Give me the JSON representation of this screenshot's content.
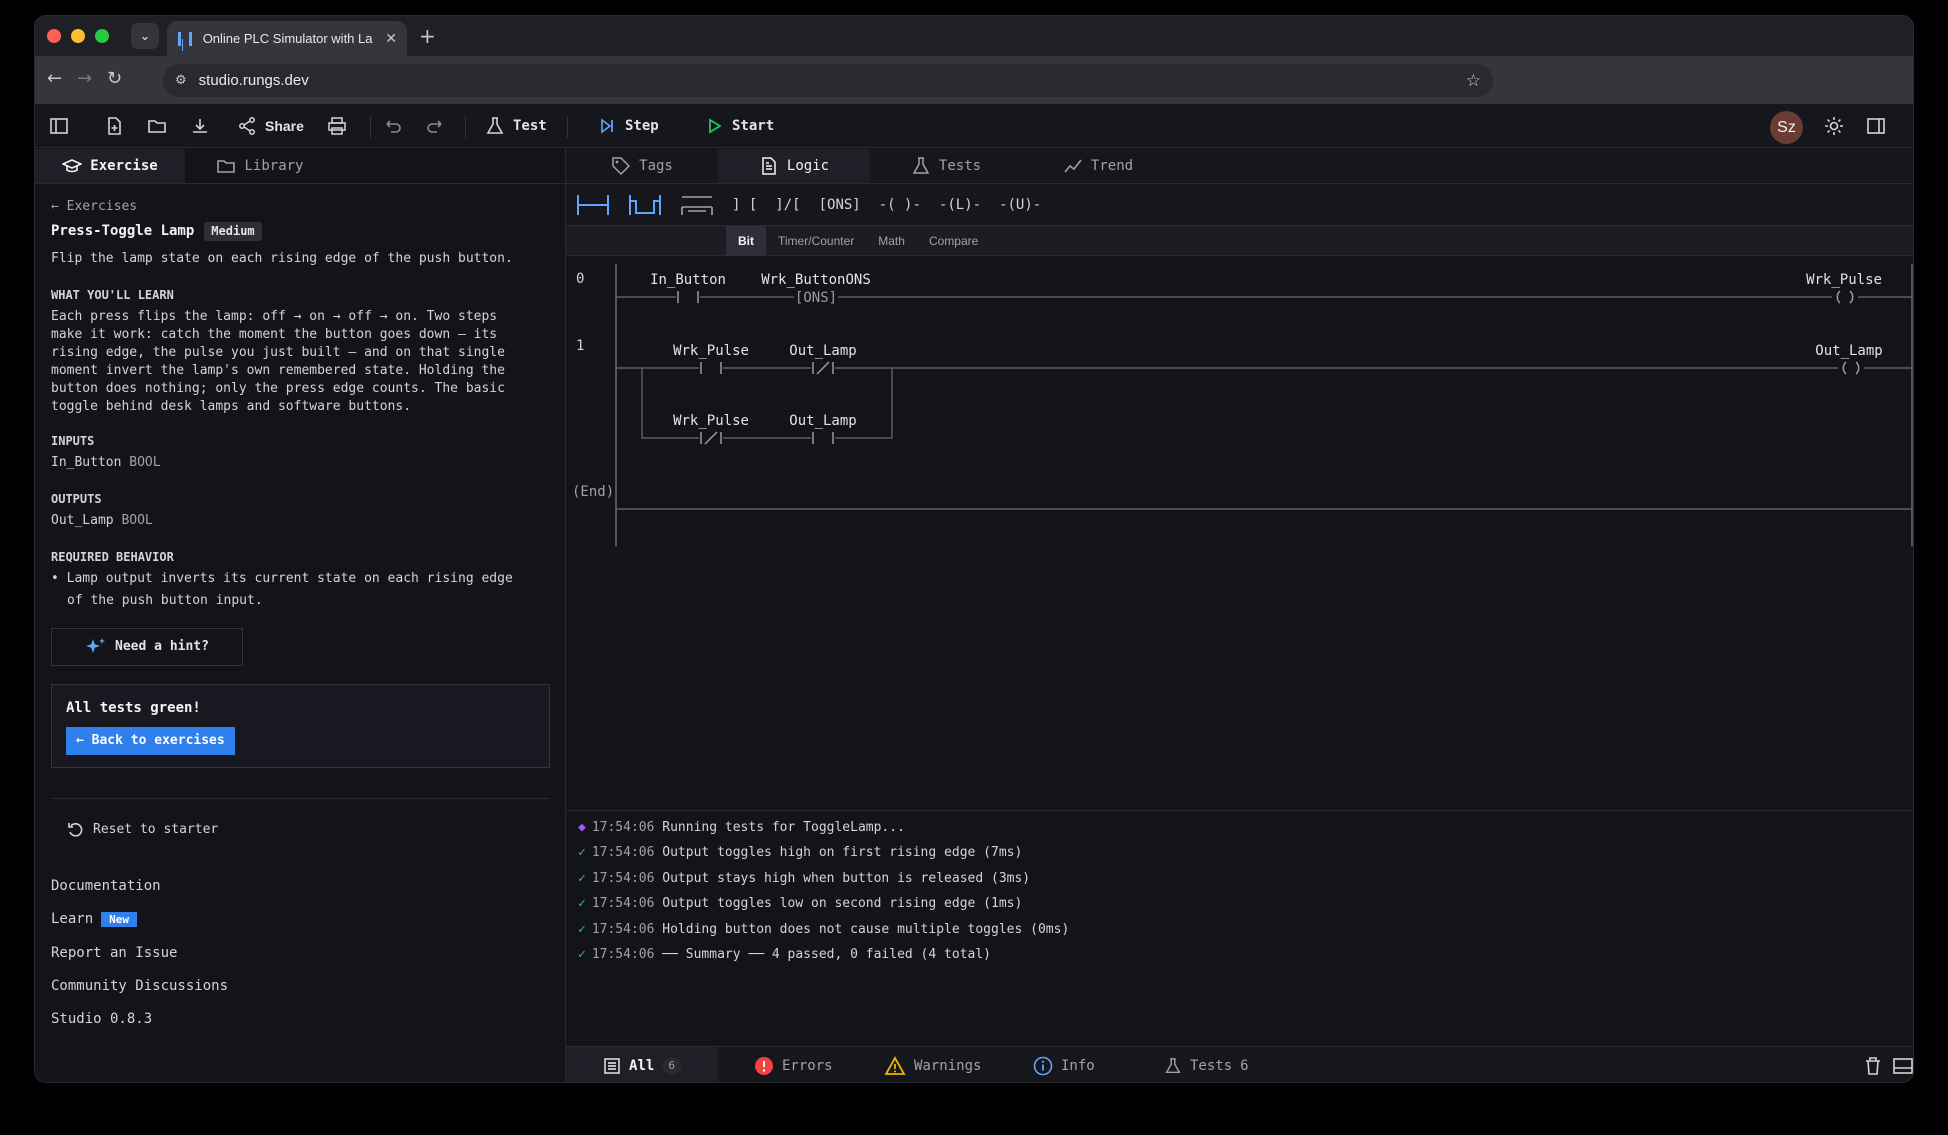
{
  "browser": {
    "tab_title": "Online PLC Simulator with La",
    "url": "studio.rungs.dev"
  },
  "toolbar": {
    "share": "Share",
    "test": "Test",
    "step": "Step",
    "start": "Start",
    "avatar": "Sz"
  },
  "left_tabs": {
    "exercise": "Exercise",
    "library": "Library"
  },
  "exercise": {
    "back": "← Exercises",
    "title": "Press-Toggle Lamp",
    "difficulty": "Medium",
    "summary": "Flip the lamp state on each rising edge of the push button.",
    "learn_heading": "WHAT YOU'LL LEARN",
    "learn_lines": [
      "Each press flips the lamp: off → on → off → on. Two steps",
      "make it work: catch the moment the button goes down — its",
      "rising edge, the pulse you just built — and on that single",
      "moment invert the lamp's own remembered state. Holding the",
      "button does nothing; only the press edge counts. The basic",
      "toggle behind desk lamps and software buttons."
    ],
    "inputs_heading": "INPUTS",
    "input_name": "In_Button",
    "input_type": "BOOL",
    "outputs_heading": "OUTPUTS",
    "output_name": "Out_Lamp",
    "output_type": "BOOL",
    "behavior_heading": "REQUIRED BEHAVIOR",
    "behavior_line1": "• Lamp output inverts its current state on each rising edge",
    "behavior_line2": "of the push button input.",
    "hint": "Need a hint?",
    "success": "All tests green!",
    "back_btn": "← Back to exercises",
    "reset": "Reset to starter"
  },
  "links": {
    "docs": "Documentation",
    "learn": "Learn",
    "learn_badge": "New",
    "report": "Report an Issue",
    "community": "Community Discussions",
    "version": "Studio 0.8.3"
  },
  "right_tabs": {
    "tags": "Tags",
    "logic": "Logic",
    "tests": "Tests",
    "trend": "Trend"
  },
  "palette": {
    "xic": "]  [",
    "xio": "]/[",
    "ons": "[ONS]",
    "ote": "-( )-",
    "otl": "-(L)-",
    "otu": "-(U)-"
  },
  "subtabs": {
    "bit": "Bit",
    "timer": "Timer/Counter",
    "math": "Math",
    "compare": "Compare"
  },
  "ladder": {
    "rung0": {
      "num": "0",
      "c1": "In_Button",
      "c2": "Wrk_ButtonONS",
      "ons": "[ONS]",
      "coil": "Wrk_Pulse"
    },
    "rung1": {
      "num": "1",
      "c1": "Wrk_Pulse",
      "c2": "Out_Lamp",
      "b1": "Wrk_Pulse",
      "b2": "Out_Lamp",
      "coil": "Out_Lamp"
    },
    "end": "(End)"
  },
  "console": {
    "lines": [
      {
        "ts": "17:54:06",
        "msg": "Running tests for ToggleLamp..."
      },
      {
        "ts": "17:54:06",
        "msg": "Output toggles high on first rising edge (7ms)"
      },
      {
        "ts": "17:54:06",
        "msg": "Output stays high when button is released (3ms)"
      },
      {
        "ts": "17:54:06",
        "msg": "Output toggles low on second rising edge (1ms)"
      },
      {
        "ts": "17:54:06",
        "msg": "Holding button does not cause multiple toggles (0ms)"
      },
      {
        "ts": "17:54:06",
        "msg": "── Summary ── 4 passed, 0 failed (4 total)"
      }
    ],
    "run_mark": "◆",
    "ok_mark": "✓"
  },
  "bottom": {
    "all": "All",
    "all_count": "6",
    "errors": "Errors",
    "warnings": "Warnings",
    "info": "Info",
    "tests": "Tests",
    "tests_count": "6"
  },
  "colors": {
    "accent": "#2f80ed",
    "success": "#22c55e",
    "play": "#22c55e",
    "error": "#ef4444",
    "warning": "#eab308",
    "info": "#60a5fa"
  }
}
